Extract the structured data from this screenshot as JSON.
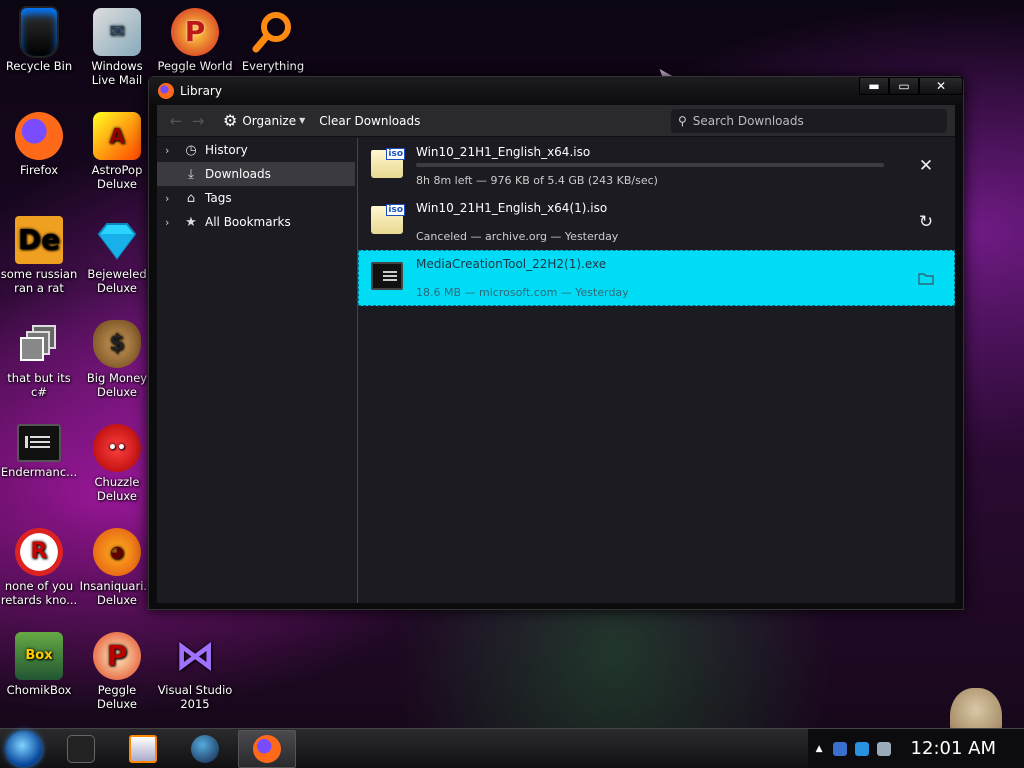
{
  "desktop": {
    "icons": [
      {
        "label": "Recycle Bin",
        "icon": "recycle-bin-icon"
      },
      {
        "label": "Windows Live Mail",
        "icon": "mail-icon"
      },
      {
        "label": "Peggle World",
        "icon": "peggle-icon",
        "glyph": "P"
      },
      {
        "label": "Everything",
        "icon": "magnifier-icon"
      },
      {
        "label": "Firefox",
        "icon": "firefox-icon"
      },
      {
        "label": "AstroPop Deluxe",
        "icon": "astropop-icon",
        "glyph": "A"
      },
      {
        "label": "some russian ran a rat",
        "icon": "de-icon",
        "glyph": "De"
      },
      {
        "label": "Bejeweled Deluxe",
        "icon": "gem-icon"
      },
      {
        "label": "that but its c#",
        "icon": "windows-stack-icon"
      },
      {
        "label": "Big Money Deluxe",
        "icon": "money-bag-icon",
        "glyph": "$"
      },
      {
        "label": "Endermanc...",
        "icon": "terminal-icon"
      },
      {
        "label": "Chuzzle Deluxe",
        "icon": "chuzzle-icon",
        "glyph": "••"
      },
      {
        "label": "none of you retards kno...",
        "icon": "dino-icon",
        "glyph": "R"
      },
      {
        "label": "Insaniquari... Deluxe",
        "icon": "fish-icon",
        "glyph": "◕"
      },
      {
        "label": "ChomikBox",
        "icon": "chomikbox-icon",
        "glyph": "Box"
      },
      {
        "label": "Peggle Deluxe",
        "icon": "peggle-deluxe-icon",
        "glyph": "P"
      },
      {
        "label": "Visual Studio 2015",
        "icon": "visual-studio-icon",
        "glyph": "⋈"
      }
    ]
  },
  "window": {
    "title": "Library",
    "controls": {
      "minimize": "▬",
      "maximize": "▭",
      "close": "✕"
    }
  },
  "toolbar": {
    "back": "←",
    "forward": "→",
    "organize_label": "Organize",
    "clear_label": "Clear Downloads",
    "search_placeholder": "Search Downloads"
  },
  "sidebar": {
    "items": [
      {
        "label": "History",
        "twisty": "›",
        "icon": "clock-icon",
        "glyph": "◷",
        "selected": false
      },
      {
        "label": "Downloads",
        "twisty": "",
        "icon": "download-icon",
        "glyph": "⤓",
        "selected": true
      },
      {
        "label": "Tags",
        "twisty": "›",
        "icon": "tag-icon",
        "glyph": "⌂",
        "selected": false
      },
      {
        "label": "All Bookmarks",
        "twisty": "›",
        "icon": "star-icon",
        "glyph": "★",
        "selected": false
      }
    ]
  },
  "downloads": [
    {
      "name": "Win10_21H1_English_x64.iso",
      "status": "8h 8m left — 976 KB of 5.4 GB (243 KB/sec)",
      "type": "iso",
      "type_label": "iso",
      "progress": 0.0,
      "action": "cancel",
      "action_glyph": "✕"
    },
    {
      "name": "Win10_21H1_English_x64(1).iso",
      "status": "Canceled — archive.org — Yesterday",
      "type": "iso",
      "type_label": "iso",
      "action": "retry",
      "action_glyph": "↻"
    },
    {
      "name": "MediaCreationTool_22H2(1).exe",
      "status": "18.6 MB — microsoft.com — Yesterday",
      "type": "exe",
      "action": "open-folder",
      "action_glyph": "▭"
    }
  ],
  "taskbar": {
    "apps": [
      "terminal",
      "media-player",
      "globe",
      "firefox"
    ],
    "tray_up": "▲",
    "clock": "12:01 AM"
  },
  "colors": {
    "selection": "#00dcf5",
    "window_bg": "#1c1b22",
    "toolbar_bg": "#2a2a2e"
  }
}
